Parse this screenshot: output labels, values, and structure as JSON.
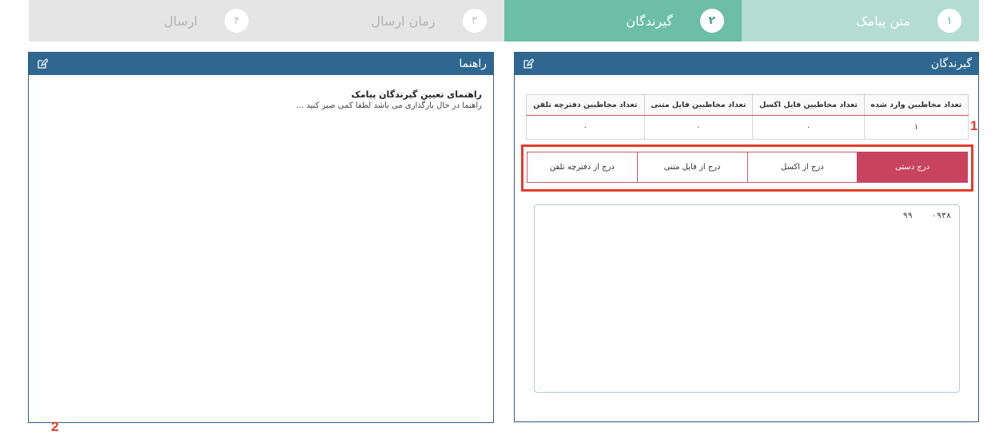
{
  "stepper": {
    "steps": [
      {
        "number": "۱",
        "label": "متن پیامک",
        "state": "done"
      },
      {
        "number": "۲",
        "label": "گیرندگان",
        "state": "active"
      },
      {
        "number": "۳",
        "label": "زمان ارسال",
        "state": "pending"
      },
      {
        "number": "۴",
        "label": "ارسال",
        "state": "pending"
      }
    ]
  },
  "recipients": {
    "title": "گیرندگان",
    "counts": {
      "headers": [
        "تعداد مخاطبین وارد شده",
        "تعداد مخاطبین فایل اکسل",
        "تعداد مخاطبین فایل متنی",
        "تعداد مخاطبین دفترچه تلفن"
      ],
      "values": [
        "۱",
        "۰",
        "۰",
        "۰"
      ]
    },
    "tabs": [
      "درج دستی",
      "درج از اکسل",
      "درج از فایل متنی",
      "درج از دفترچه تلفن"
    ],
    "active_tab": 0,
    "textarea_value": "۰۹۳۸    ۹۹"
  },
  "guide": {
    "title": "راهنما",
    "heading": "راهنمای تعیین گیرندگان پیامک",
    "text": "راهنما در حال بارگذاری می باشد لطفا کمی صبر کنید ..."
  },
  "annotations": {
    "marker1": "1",
    "marker2": "2"
  },
  "colors": {
    "header": "#2f6790",
    "step_done": "#b4ddd1",
    "step_active": "#6cbea6",
    "step_pending": "#e5e5e5",
    "tab_active": "#c8435f",
    "highlight": "#e43b28"
  },
  "icons": {
    "panel_edit": "edit-icon"
  }
}
